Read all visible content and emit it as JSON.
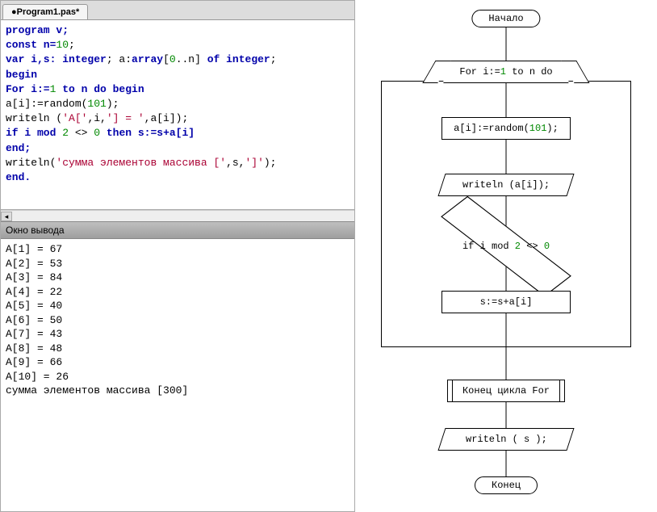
{
  "tab": {
    "title": "●Program1.pas*"
  },
  "code": {
    "l1": "program v;",
    "l2a": "const n=",
    "l2b": "10",
    "l2c": ";",
    "l3a": "var i,s: ",
    "l3kw1": "integer",
    "l3b": "; a:",
    "l3kw2": "array",
    "l3c": "[",
    "l3n1": "0",
    "l3d": "..n] ",
    "l3kw3": "of",
    "l3e": " ",
    "l3kw4": "integer",
    "l3f": ";",
    "l4": "begin",
    "l5a": "For i:=",
    "l5n1": "1",
    "l5b": " to n do begin",
    "l6a": "a[i]:=random(",
    "l6n": "101",
    "l6b": ");",
    "l7a": "writeln (",
    "l7s1": "'A['",
    "l7b": ",i,",
    "l7s2": "'] = '",
    "l7c": ",a[i]);",
    "l8a": "if i mod ",
    "l8n1": "2",
    "l8b": " <> ",
    "l8n2": "0",
    "l8c": " then s:=s+a[i]",
    "l9": "end;",
    "l10a": "writeln(",
    "l10s": "'сумма элементов массива ['",
    "l10b": ",s,",
    "l10s2": "']'",
    "l10c": ");",
    "l11": "end."
  },
  "output_header": "Окно вывода",
  "output": {
    "lines": [
      "A[1] = 67",
      "A[2] = 53",
      "A[3] = 84",
      "A[4] = 22",
      "A[5] = 40",
      "A[6] = 50",
      "A[7] = 43",
      "A[8] = 48",
      "A[9] = 66",
      "A[10] = 26",
      "сумма элементов массива [300]"
    ]
  },
  "flow": {
    "start": "Начало",
    "loop_a": "For i:=",
    "loop_n": "1",
    "loop_b": " to n do",
    "step2a": "a[i]:=random(",
    "step2n": "101",
    "step2b": ");",
    "step3": "writeln (a[i]);",
    "cond_a": "if i mod ",
    "cond_n1": "2",
    "cond_b": " <> ",
    "cond_n2": "0",
    "step5": "s:=s+a[i]",
    "endloop": "Конец цикла For",
    "step7": "writeln ( s );",
    "end": "Конец"
  }
}
